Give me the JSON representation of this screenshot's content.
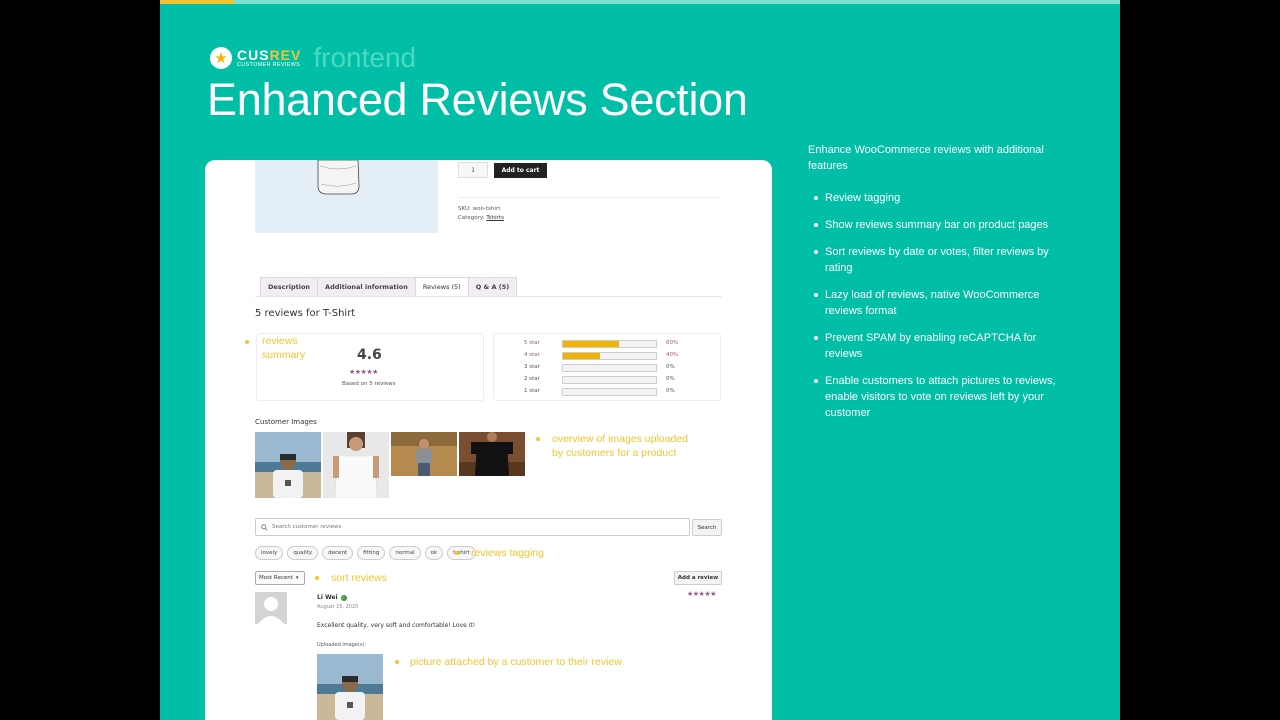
{
  "brand": {
    "name_part1": "CUS",
    "name_part2": "REV",
    "subtitle": "CUSTOMER REVIEWS",
    "tag": "frontend"
  },
  "headline": "Enhanced Reviews Section",
  "intro": "Enhance WooCommerce reviews with additional features",
  "features": [
    "Review tagging",
    "Show reviews summary bar on product pages",
    "Sort reviews by date or votes, filter reviews by rating",
    "Lazy load of reviews, native WooCommerce reviews format",
    "Prevent SPAM by enabling reCAPTCHA for reviews",
    "Enable customers to attach pictures to reviews, enable visitors to vote on reviews left by your customer"
  ],
  "product": {
    "qty": "1",
    "add_to_cart": "Add to cart",
    "sku": "SKU: woo-tshirt",
    "category_label": "Category:",
    "category_value": "Tshirts"
  },
  "tabs": [
    "Description",
    "Additional information",
    "Reviews (5)",
    "Q & A (5)"
  ],
  "reviews_title": "5 reviews for T-Shirt",
  "summary": {
    "rating": "4.6",
    "stars": "★★★★★",
    "based_on": "Based on 5 reviews",
    "bars": [
      {
        "label": "5 star",
        "pct_text": "60%",
        "value": 0.6,
        "highlight": true
      },
      {
        "label": "4 star",
        "pct_text": "40%",
        "value": 0.4,
        "highlight": true
      },
      {
        "label": "3 star",
        "pct_text": "0%",
        "value": 0,
        "highlight": false
      },
      {
        "label": "2 star",
        "pct_text": "0%",
        "value": 0,
        "highlight": false
      },
      {
        "label": "1 star",
        "pct_text": "0%",
        "value": 0,
        "highlight": false
      }
    ]
  },
  "customer_images_title": "Customer Images",
  "search": {
    "placeholder": "Search customer reviews",
    "button": "Search"
  },
  "tags": [
    "lovely",
    "quality",
    "decent",
    "fitting",
    "normal",
    "ok",
    "t-shirt"
  ],
  "sort": {
    "value": "Most Recent"
  },
  "add_review": "Add a review",
  "review": {
    "name": "Li Wei",
    "date": "August 15, 2020",
    "stars": "★★★★★",
    "text": "Excellent quality, very soft and comfortable! Love it!",
    "uploaded_label": "Uploaded image(s):"
  },
  "annotations": {
    "summary_line1": "reviews",
    "summary_line2": "summary",
    "images_line1": "overview of images uploaded",
    "images_line2": "by customers for a product",
    "tagging": "reviews tagging",
    "sort": "sort reviews",
    "picture": "picture attached by a customer to their review"
  },
  "colors": {
    "background": "#00bfa6",
    "accent": "#f4c430",
    "star": "#96588a",
    "bar": "#f0b400"
  }
}
